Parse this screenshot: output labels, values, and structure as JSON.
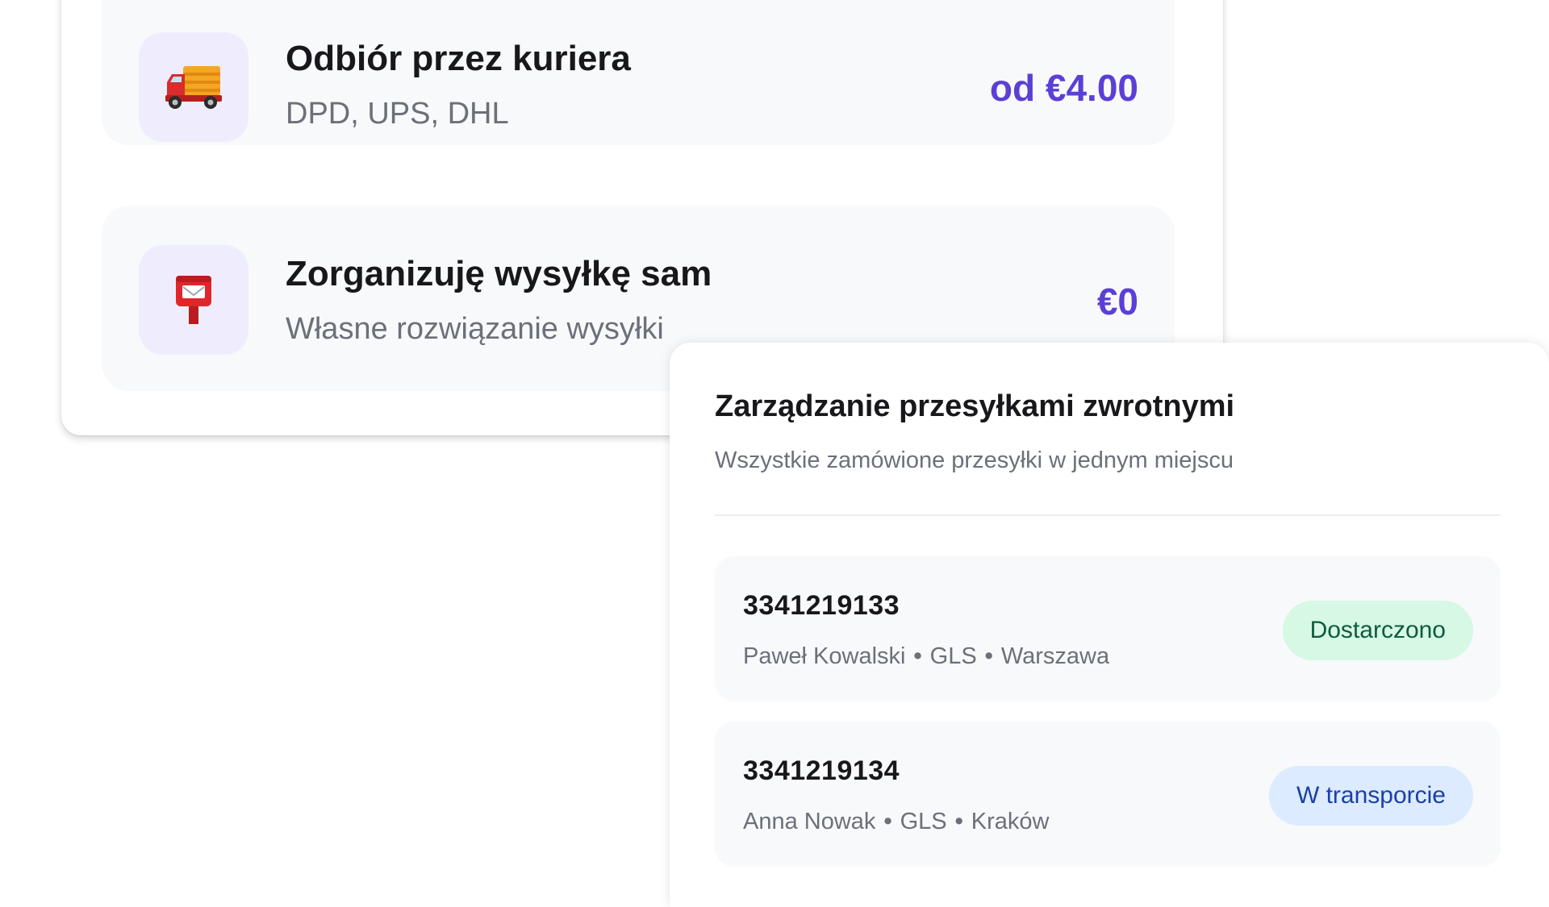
{
  "shipping_options": [
    {
      "icon": "delivery-truck-icon",
      "title": "Odbiór przez kuriera",
      "subtitle": "DPD, UPS, DHL",
      "price": "od €4.00"
    },
    {
      "icon": "postbox-icon",
      "title": "Zorganizuję wysyłkę sam",
      "subtitle": "Własne rozwiązanie wysyłki",
      "price": "€0"
    }
  ],
  "returns": {
    "title": "Zarządzanie przesyłkami zwrotnymi",
    "subtitle": "Wszystkie zamówione przesyłki w jednym miejscu",
    "shipments": [
      {
        "number": "3341219133",
        "name": "Paweł Kowalski",
        "carrier": "GLS",
        "city": "Warszawa",
        "separator": "•",
        "status": "Dostarczono"
      },
      {
        "number": "3341219134",
        "name": "Anna Nowak",
        "carrier": "GLS",
        "city": "Kraków",
        "separator": "•",
        "status": "W transporcie"
      }
    ]
  },
  "colors": {
    "accent_price": "#5b3fd6",
    "icon_box_bg": "#efedfd",
    "delivered_bg": "#d6f8e4",
    "delivered_text": "#0c5d38",
    "in_transit_bg": "#dcebff",
    "in_transit_text": "#1c3fa8"
  }
}
